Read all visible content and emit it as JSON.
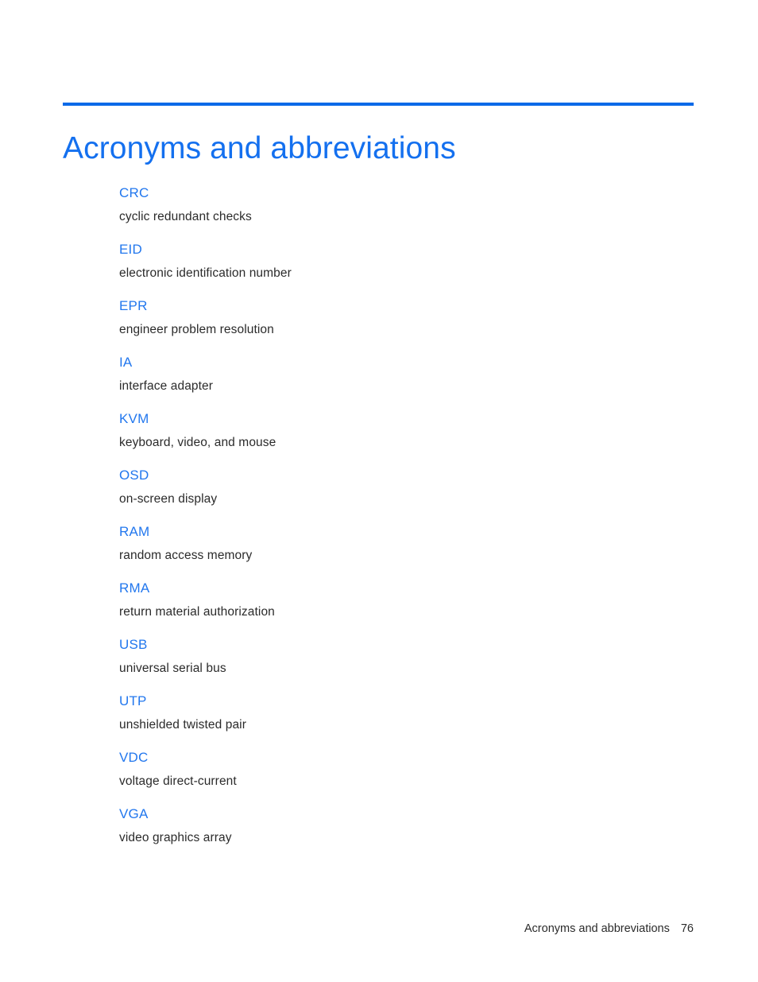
{
  "document": {
    "title": "Acronyms and abbreviations",
    "accent_color": "#1470ef",
    "rule_color": "#0b6ae8",
    "text_color": "#2b2b2b",
    "background_color": "#ffffff"
  },
  "glossary": {
    "entries": [
      {
        "term": "CRC",
        "definition": "cyclic redundant checks"
      },
      {
        "term": "EID",
        "definition": "electronic identification number"
      },
      {
        "term": "EPR",
        "definition": "engineer problem resolution"
      },
      {
        "term": "IA",
        "definition": "interface adapter"
      },
      {
        "term": "KVM",
        "definition": "keyboard, video, and mouse"
      },
      {
        "term": "OSD",
        "definition": "on-screen display"
      },
      {
        "term": "RAM",
        "definition": "random access memory"
      },
      {
        "term": "RMA",
        "definition": "return material authorization"
      },
      {
        "term": "USB",
        "definition": "universal serial bus"
      },
      {
        "term": "UTP",
        "definition": "unshielded twisted pair"
      },
      {
        "term": "VDC",
        "definition": "voltage direct-current"
      },
      {
        "term": "VGA",
        "definition": "video graphics array"
      }
    ]
  },
  "footer": {
    "label": "Acronyms and abbreviations",
    "page_number": "76"
  }
}
